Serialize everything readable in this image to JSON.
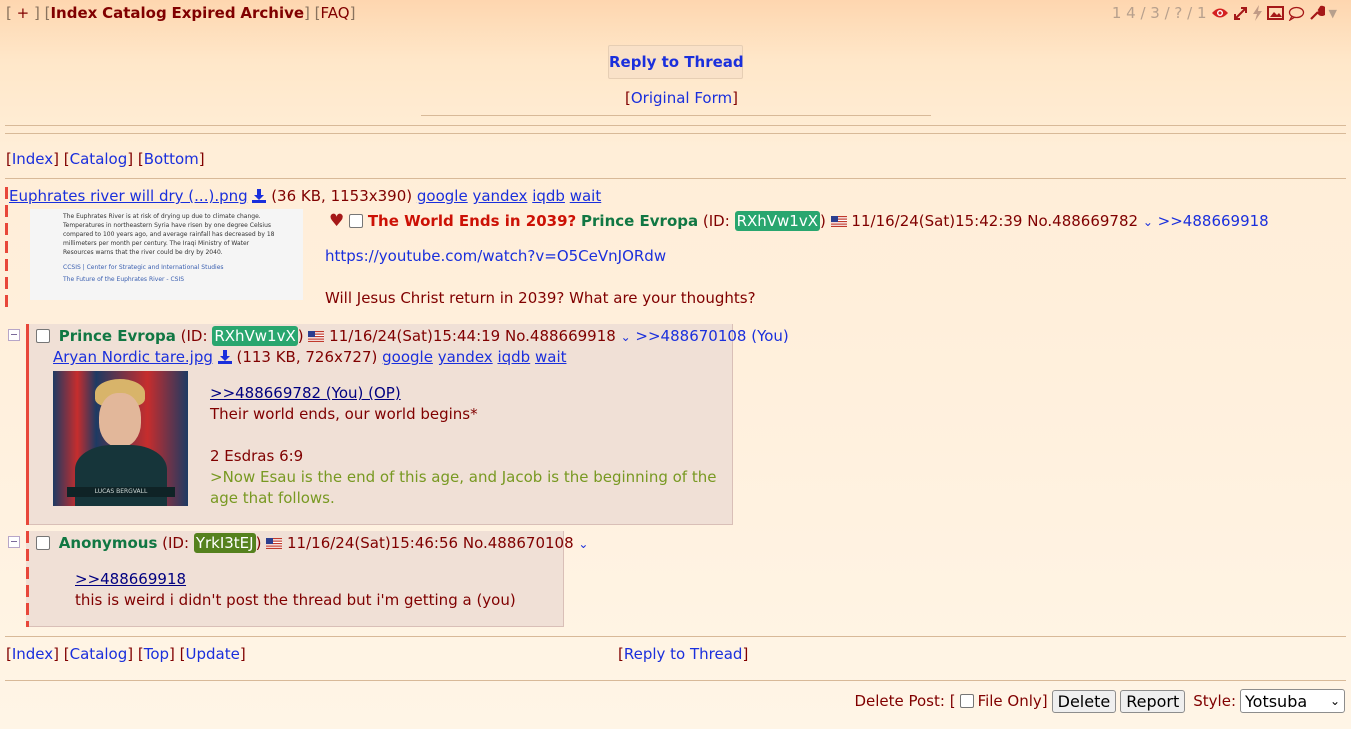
{
  "topnav": {
    "plus": "+",
    "links": [
      "Index",
      "Catalog",
      "Expired",
      "Archive"
    ],
    "faq": "FAQ"
  },
  "stats": {
    "text": "1 4 / 3 / ? / 1"
  },
  "reply_button": "Reply to Thread",
  "original_form": "Original Form",
  "nav_top": [
    "Index",
    "Catalog",
    "Bottom"
  ],
  "op": {
    "file": {
      "name": "Euphrates river will dry (...).png",
      "info": "(36 KB, 1153x390)",
      "search": [
        "google",
        "yandex",
        "iqdb",
        "wait"
      ]
    },
    "thumb_lines": [
      "The Euphrates River is at risk of drying up due to climate change.",
      "Temperatures in northeastern Syria have risen by one degree Celsius",
      "compared to 100 years ago, and average rainfall has decreased by 18",
      "millimeters per month per century. The Iraqi Ministry of Water",
      "Resources warns that the river could be dry by 2040.",
      "CCSIS | Center for Strategic and International Studies",
      "The Future of the Euphrates River - CSIS"
    ],
    "subject": "The World Ends in 2039?",
    "name": "Prince Evropa",
    "id": "RXhVw1vX",
    "date": "11/16/24(Sat)15:42:39",
    "no": "No.488669782",
    "backlink": ">>488669918",
    "link": "https://youtube.com/watch?v=O5CeVnJORdw",
    "text": "Will Jesus Christ return in 2039? What are your thoughts?"
  },
  "reply1": {
    "name": "Prince Evropa",
    "id": "RXhVw1vX",
    "date": "11/16/24(Sat)15:44:19",
    "no": "No.488669918",
    "backlink": ">>488670108 (You)",
    "file": {
      "name": "Aryan Nordic tare.jpg",
      "info": "(113 KB, 726x727)",
      "search": [
        "google",
        "yandex",
        "iqdb",
        "wait"
      ]
    },
    "quotelink": ">>488669782 (You) (OP)",
    "line1": "Their world ends, our world begins*",
    "line2": "2 Esdras 6:9",
    "greentext1": ">Now Esau is the end of this age, and Jacob is the beginning of the",
    "greentext2": "age that follows.",
    "thumb_caption": "LUCAS BERGVALL"
  },
  "reply2": {
    "name": "Anonymous",
    "id": "YrkI3tEJ",
    "date": "11/16/24(Sat)15:46:56",
    "no": "No.488670108",
    "quotelink": ">>488669918",
    "text": "this is weird i didn't post the thread but i'm getting a (you)"
  },
  "nav_bottom": [
    "Index",
    "Catalog",
    "Top",
    "Update"
  ],
  "nav_bottom_right": "Reply to Thread",
  "bottombar": {
    "delete_label": "Delete Post: [",
    "file_only": "File Only]",
    "delete_btn": "Delete",
    "report_btn": "Report",
    "style_label": "Style:",
    "style_value": "Yotsuba"
  },
  "colors": {
    "subject": "#cc1105",
    "name": "#117743",
    "id1": "#29a66f",
    "id2": "#55811e",
    "link": "#1a2fdc"
  }
}
